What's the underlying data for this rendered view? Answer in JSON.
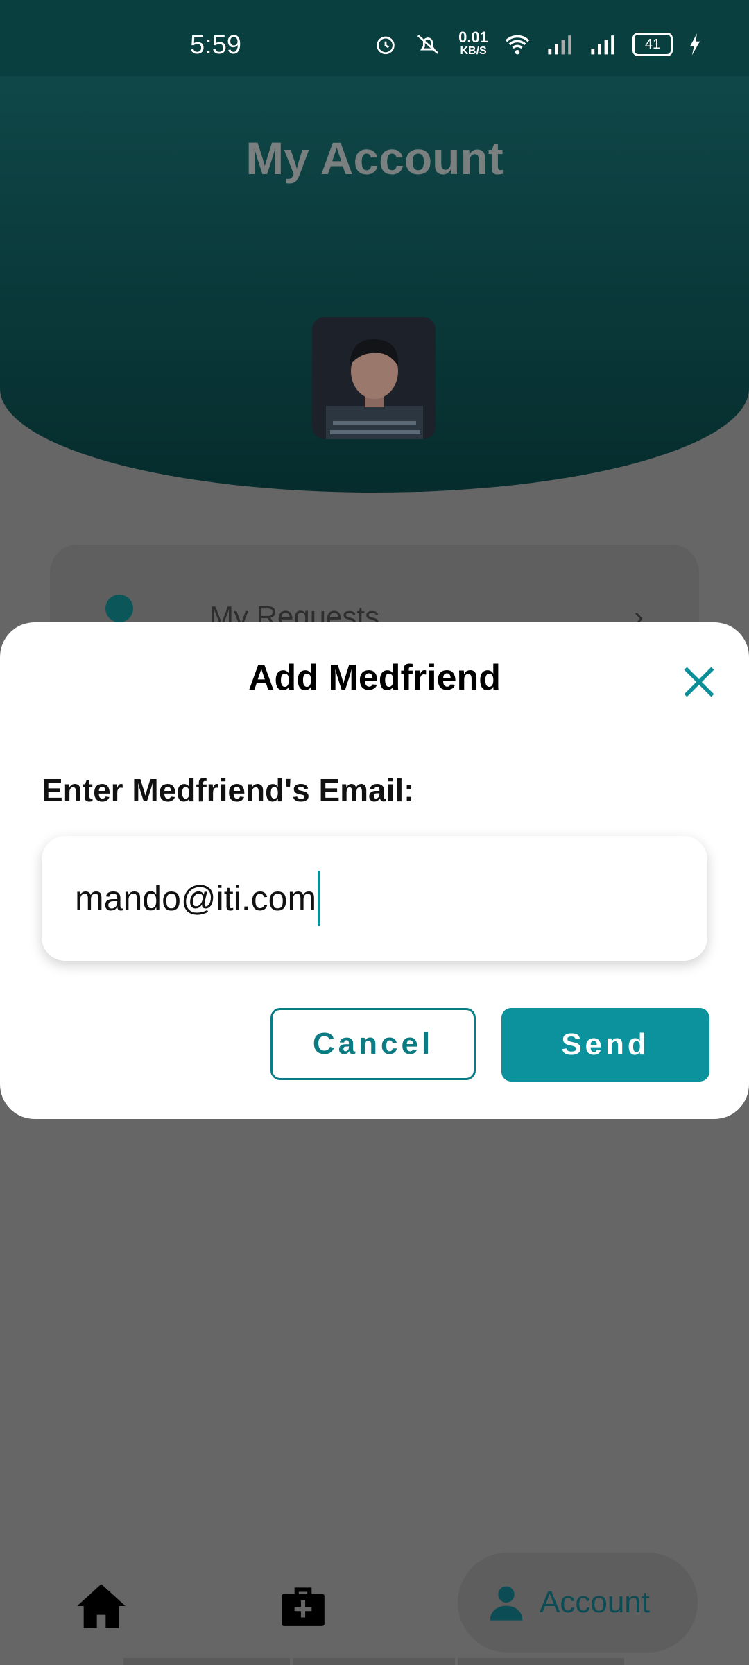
{
  "status_bar": {
    "time": "5:59",
    "net_speed": "0.01",
    "net_unit": "KB/S",
    "battery": "41",
    "icons": [
      "alarm-icon",
      "mute-icon",
      "wifi-icon",
      "signal-icon",
      "signal-icon",
      "charging-icon"
    ]
  },
  "header": {
    "title": "My Account"
  },
  "background_menu": {
    "item_label": "My Requests"
  },
  "dialog": {
    "title": "Add Medfriend",
    "email_label": "Enter Medfriend's Email:",
    "email_value": "mando@iti.com",
    "cancel_label": "Cancel",
    "send_label": "Send"
  },
  "bottom_nav": {
    "items": [
      {
        "icon": "home-icon",
        "label": ""
      },
      {
        "icon": "medical-kit-icon",
        "label": ""
      },
      {
        "icon": "person-icon",
        "label": "Account"
      }
    ],
    "active": "Account"
  },
  "colors": {
    "accent": "#0b929c",
    "header_dark": "#0a3f40",
    "overlay": "#666666"
  }
}
